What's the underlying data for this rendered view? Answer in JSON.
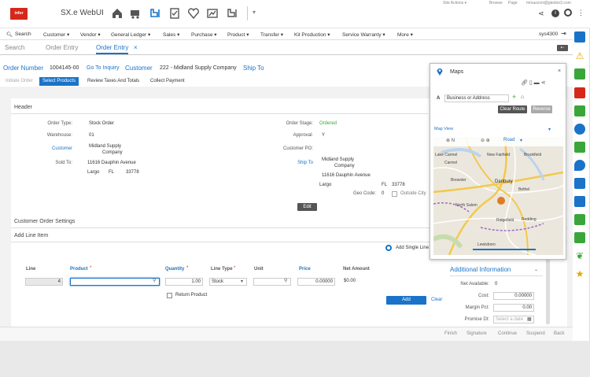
{
  "header": {
    "logo": "infor",
    "app_title": "SX.e WebUI",
    "top_links": [
      "Site Actions ▾",
      "Browse",
      "Page"
    ],
    "user": "mmazzoni@gtedior3.com",
    "company": "sys4300"
  },
  "menu": [
    "Search",
    "Customer ▾",
    "Vendor ▾",
    "General Ledger ▾",
    "Sales ▾",
    "Purchase ▾",
    "Product ▾",
    "Transfer ▾",
    "Kit Production ▾",
    "Service Warranty ▾",
    "More ▾"
  ],
  "tabs": [
    "Search",
    "Order Entry",
    "Order Entry"
  ],
  "order": {
    "label": "Order Number",
    "number": "1004145-00",
    "goto": "Go To Inquiry",
    "customer_label": "Customer",
    "customer": "222 - Midland Supply Company",
    "shipto": "Ship To"
  },
  "subtabs": [
    "Initiate Order",
    "Select Products",
    "Review Taxes And Totals",
    "Collect Payment"
  ],
  "sections": {
    "header": "Header",
    "settings": "Customer Order Settings",
    "addline": "Add Line Item"
  },
  "left_fields": {
    "order_type_label": "Order Type:",
    "order_type": "Stock Order",
    "warehouse_label": "Warehouse:",
    "warehouse": "01",
    "customer_label": "Customer",
    "customer_line1": "Midland Supply",
    "customer_line2": "Company",
    "soldto_label": "Sold To:",
    "soldto_addr": "11616 Dauphin Avenue",
    "soldto_city": "Largo",
    "soldto_state": "FL",
    "soldto_zip": "33778"
  },
  "right_fields": {
    "stage_label": "Order Stage:",
    "stage": "Ordered",
    "approval_label": "Approval:",
    "approval": "Y",
    "po_label": "Customer PO:",
    "shipto_label": "Ship To",
    "shipto_line1": "Midland Supply",
    "shipto_line2": "Company",
    "shipto_addr": "11616 Dauphin Avenue",
    "shipto_city": "Largo",
    "shipto_state": "FL",
    "shipto_zip": "33778",
    "geo_label": "Geo Code:",
    "geo": "0",
    "outside_city": "Outside City"
  },
  "edit": "Edit",
  "line_item": {
    "add_single": "Add Single Line",
    "headers": [
      "Line",
      "Product",
      "Quantity",
      "Line Type",
      "Unit",
      "Price",
      "Net Amount"
    ],
    "line": "4",
    "quantity": "1.00",
    "line_type": "Stock",
    "price": "0.00000",
    "net": "$0.00",
    "return_product": "Return Product",
    "add": "Add",
    "clear": "Clear"
  },
  "additional": {
    "title": "Additional Information",
    "net_label": "Net Available:",
    "net": "0",
    "cost_label": "Cost:",
    "cost": "0.00000",
    "margin_label": "Margin Pct:",
    "margin": "0.00",
    "promise_label": "Promise Dt:",
    "promise_placeholder": "Select a date"
  },
  "maps": {
    "title": "Maps",
    "prefix": "A",
    "input_value": "Business or Address",
    "clear_route": "Clear Route",
    "reverse": "Reverse",
    "map_view": "Map View",
    "road": "Road",
    "towns": [
      "Lake Carmel",
      "Carmel",
      "New Fairfield",
      "Brookfield",
      "Brewster",
      "Danbury",
      "Bethel",
      "North Salem",
      "Redding",
      "Ridgefield",
      "Lewisboro"
    ]
  },
  "footer": [
    "Finish",
    "Signature",
    "Continue",
    "Suspend",
    "Back"
  ],
  "colors": {
    "accent": "#1a73c8",
    "brand_red": "#d5281a",
    "rail_green": "#3aa63a",
    "map_road": "#f2c94c"
  }
}
